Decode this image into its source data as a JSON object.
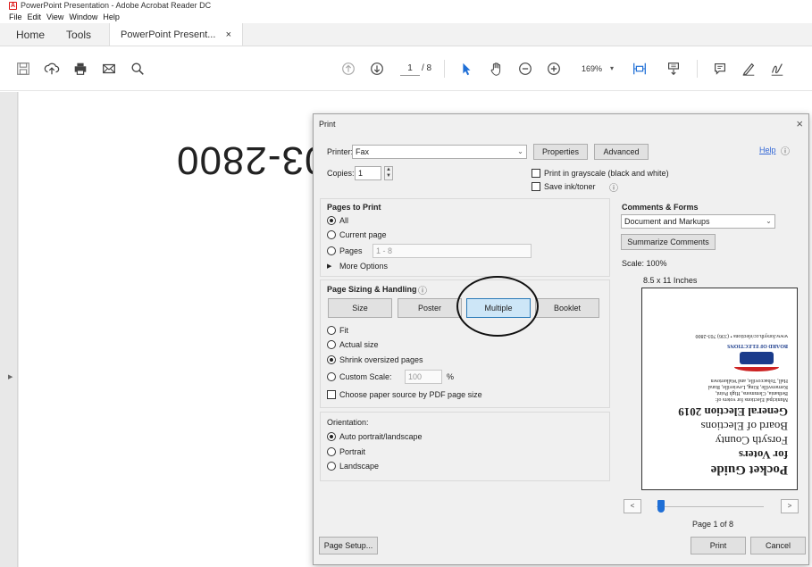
{
  "window": {
    "title": "PowerPoint Presentation - Adobe Acrobat Reader DC"
  },
  "menubar": [
    "File",
    "Edit",
    "View",
    "Window",
    "Help"
  ],
  "tabs": {
    "home": "Home",
    "tools": "Tools",
    "document": "PowerPoint Present...",
    "close": "×"
  },
  "toolbar": {
    "page_current": "1",
    "page_total": "/ 8",
    "zoom": "169%",
    "zoom_arrow": "▾"
  },
  "document": {
    "visible_text": "03-2800"
  },
  "dialog": {
    "title": "Print",
    "close": "×",
    "printer_label": "Printer:",
    "printer_value": "Fax",
    "properties_btn": "Properties",
    "advanced_btn": "Advanced",
    "help_link": "Help",
    "copies_label": "Copies:",
    "copies_value": "1",
    "grayscale_label": "Print in grayscale (black and white)",
    "save_ink_label": "Save ink/toner",
    "pages_to_print": {
      "heading": "Pages to Print",
      "all": "All",
      "current": "Current page",
      "pages": "Pages",
      "pages_value": "1 - 8",
      "more_options": "More Options"
    },
    "sizing": {
      "heading": "Page Sizing & Handling",
      "size_btn": "Size",
      "poster_btn": "Poster",
      "multiple_btn": "Multiple",
      "booklet_btn": "Booklet",
      "fit": "Fit",
      "actual": "Actual size",
      "shrink": "Shrink oversized pages",
      "custom": "Custom Scale:",
      "custom_value": "100",
      "percent": "%",
      "paper_source": "Choose paper source by PDF page size"
    },
    "orientation": {
      "heading": "Orientation:",
      "auto": "Auto portrait/landscape",
      "portrait": "Portrait",
      "landscape": "Landscape"
    },
    "comments": {
      "heading": "Comments & Forms",
      "value": "Document and Markups",
      "summarize_btn": "Summarize Comments",
      "scale": "Scale: 100%",
      "paper_size": "8.5 x 11 Inches"
    },
    "preview": {
      "title": "Pocket Guide",
      "line1": "for Voters",
      "line2": "Forsyth County",
      "line3": "Board of Elections",
      "line4": "General Election 2019",
      "small1": "Municipal Elections for voters of:",
      "small2": "Bethania, Clemmons, High Point,",
      "small3": "Kernersville, King, Lewisville, Rural",
      "small4": "Hall, Tobaccoville, and Walkertown",
      "logo_text": "BOARD OF ELECTIONS",
      "web": "www.forsyth.cc/elections • (336) 703-2800",
      "page_label": "Page 1 of 8",
      "prev": "<",
      "next": ">"
    },
    "page_setup_btn": "Page Setup...",
    "print_btn": "Print",
    "cancel_btn": "Cancel"
  }
}
